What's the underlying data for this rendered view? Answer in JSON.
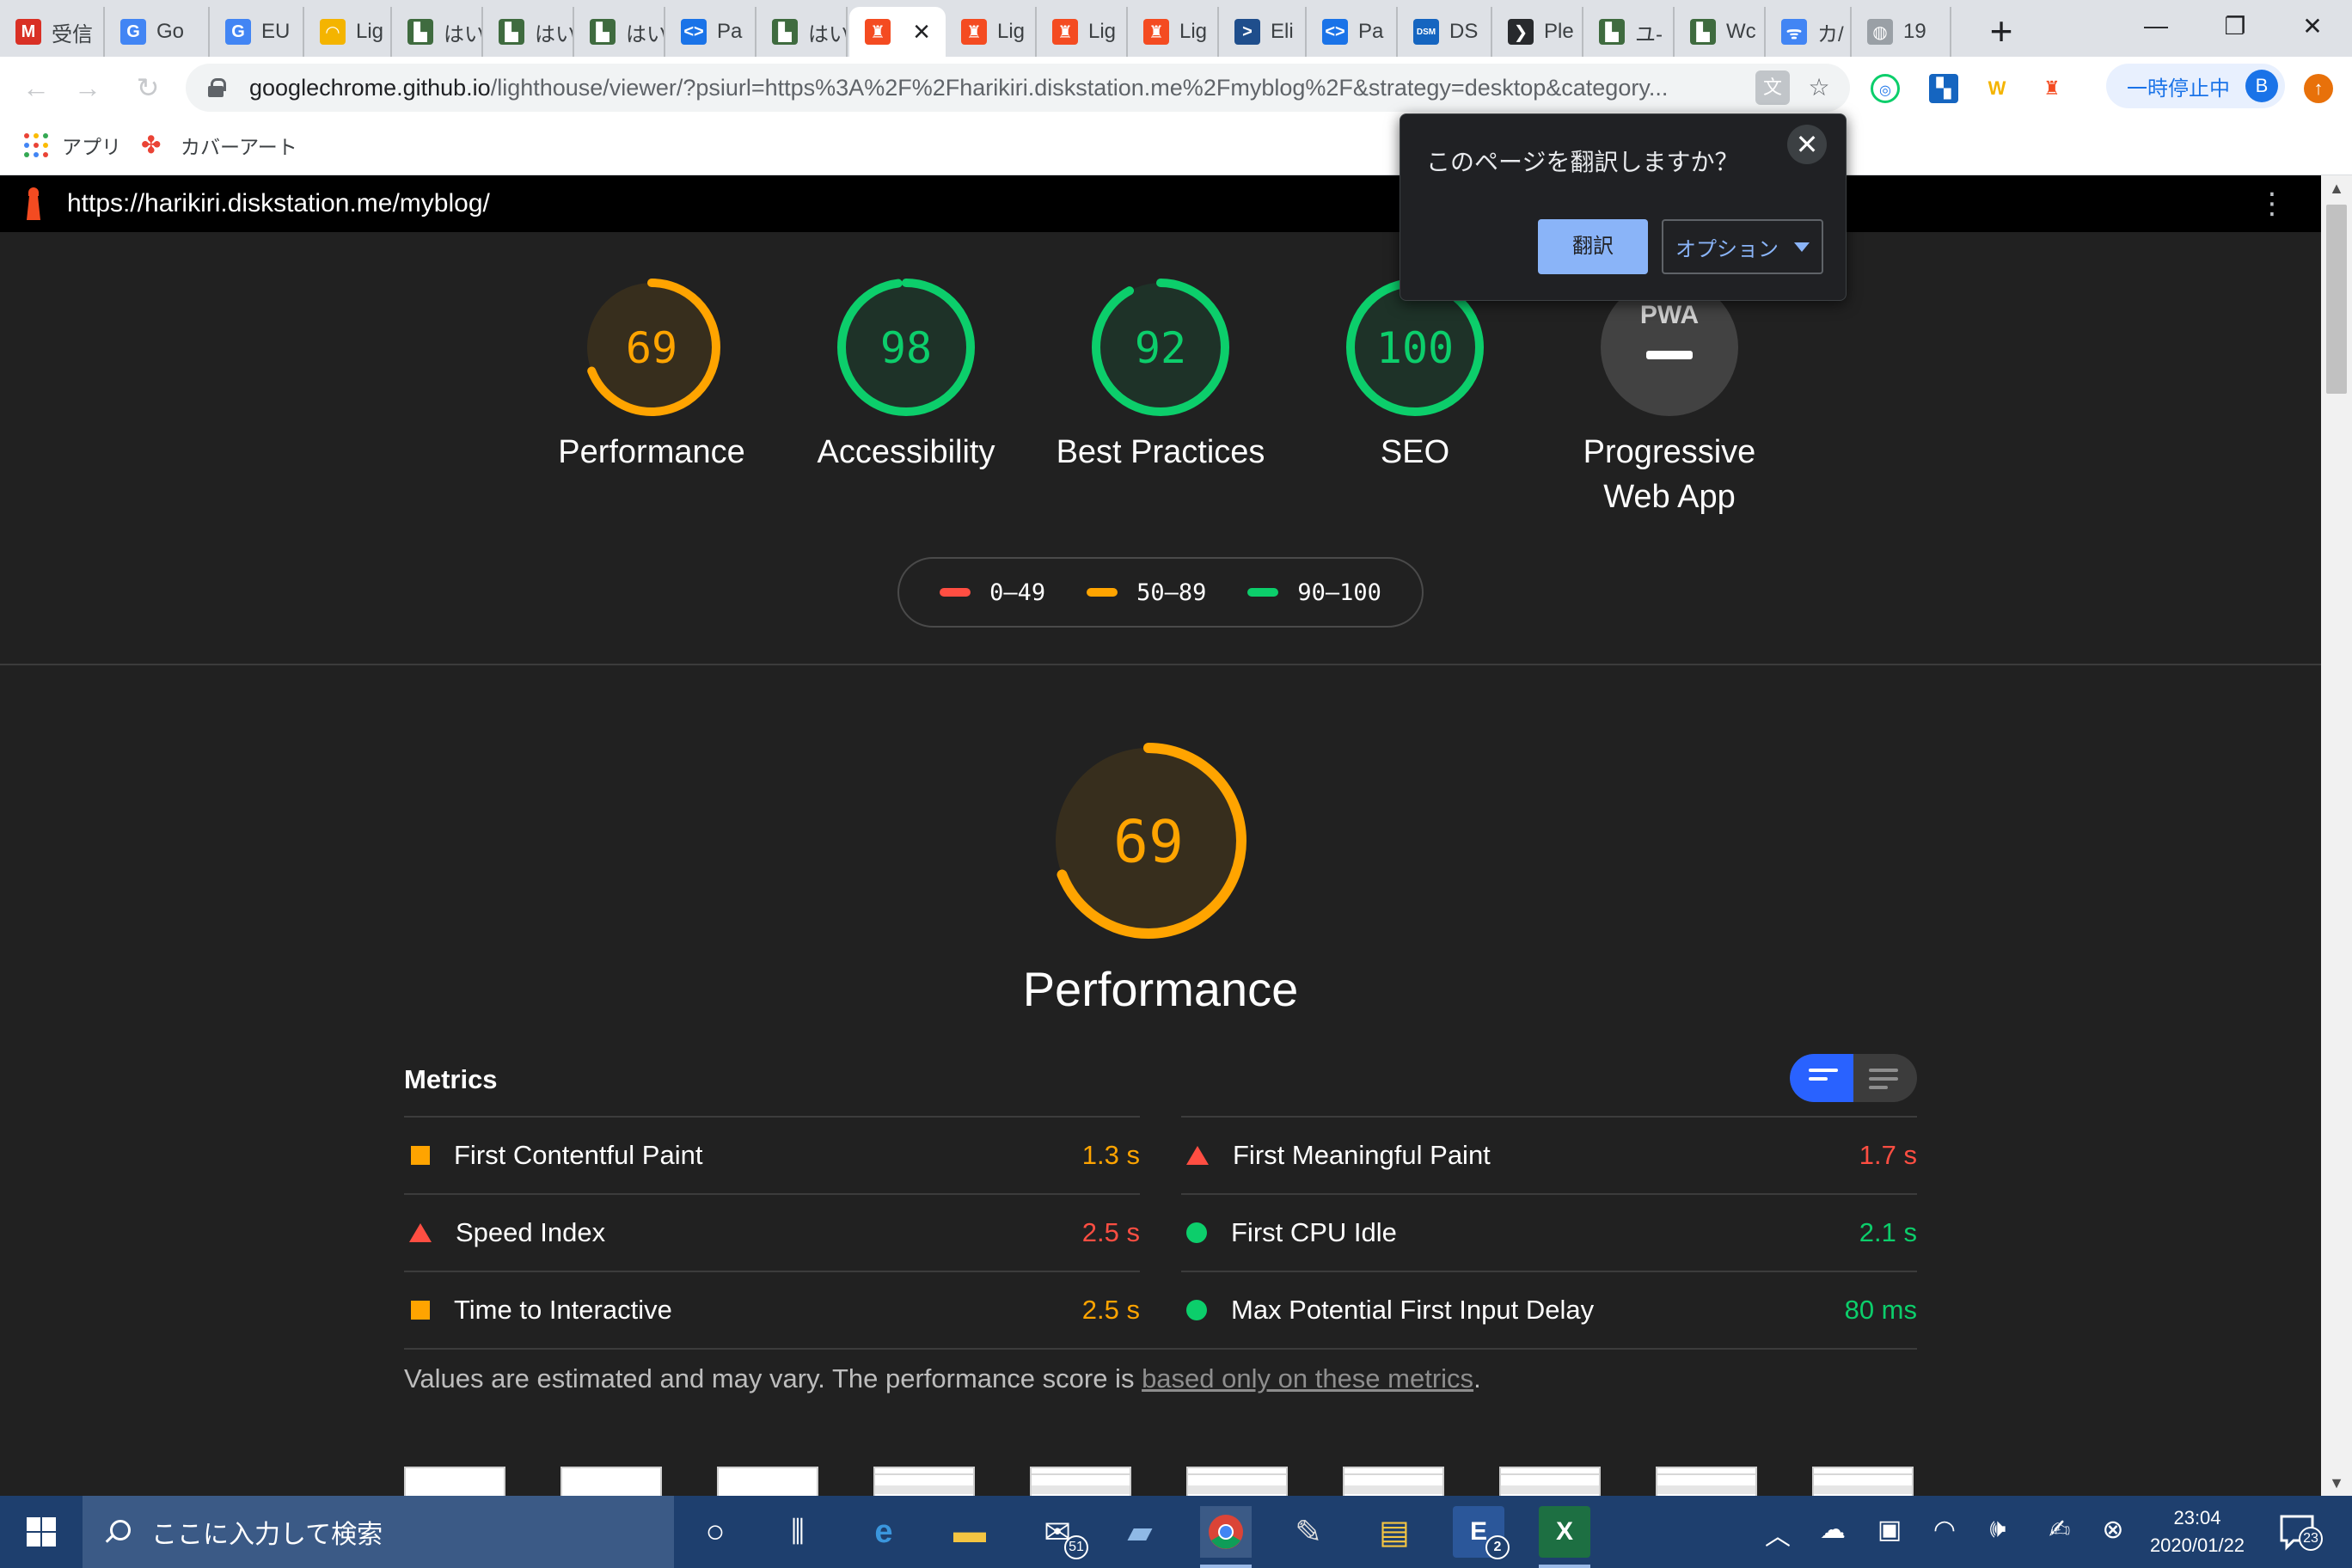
{
  "browser": {
    "tabs": [
      {
        "title": "受信",
        "icon": "gmail-icon",
        "color": "#d93025",
        "glyph": "M"
      },
      {
        "title": "Go",
        "icon": "google-icon",
        "color": "#4285f4",
        "glyph": "G"
      },
      {
        "title": "EU",
        "icon": "google-icon",
        "color": "#4285f4",
        "glyph": "G"
      },
      {
        "title": "Lig",
        "icon": "rainbow-icon",
        "color": "#f4b400",
        "glyph": "◠"
      },
      {
        "title": "はい",
        "icon": "photo-icon",
        "color": "#3f6b3f",
        "glyph": "▙"
      },
      {
        "title": "はい",
        "icon": "photo-icon",
        "color": "#3f6b3f",
        "glyph": "▙"
      },
      {
        "title": "はい",
        "icon": "photo-icon",
        "color": "#3f6b3f",
        "glyph": "▙"
      },
      {
        "title": "Pa",
        "icon": "pagespeed-icon",
        "color": "#1a73e8",
        "glyph": "<>"
      },
      {
        "title": "はい",
        "icon": "photo-icon",
        "color": "#3f6b3f",
        "glyph": "▙"
      },
      {
        "title": "",
        "icon": "lighthouse-icon",
        "color": "#f44b21",
        "glyph": "♜",
        "active": true
      },
      {
        "title": "Lig",
        "icon": "lighthouse-icon",
        "color": "#f44b21",
        "glyph": "♜"
      },
      {
        "title": "Lig",
        "icon": "lighthouse-icon",
        "color": "#f44b21",
        "glyph": "♜"
      },
      {
        "title": "Lig",
        "icon": "lighthouse-icon",
        "color": "#f44b21",
        "glyph": "♜"
      },
      {
        "title": "Eli",
        "icon": "powershell-icon",
        "color": "#1f4e8c",
        "glyph": ">"
      },
      {
        "title": "Pa",
        "icon": "pagespeed-icon",
        "color": "#1a73e8",
        "glyph": "<>"
      },
      {
        "title": "DS",
        "icon": "dsm-icon",
        "color": "#1565c0",
        "glyph": "DSM"
      },
      {
        "title": "Ple",
        "icon": "plex-icon",
        "color": "#282a2d",
        "glyph": "❯"
      },
      {
        "title": "ユ-",
        "icon": "photo-icon",
        "color": "#3f6b3f",
        "glyph": "▙"
      },
      {
        "title": "Wc",
        "icon": "photo-icon",
        "color": "#3f6b3f",
        "glyph": "▙"
      },
      {
        "title": "カ/",
        "icon": "translate-icon",
        "color": "#4285f4",
        "glyph": "ᯤ"
      },
      {
        "title": "19",
        "icon": "globe-icon",
        "color": "#9aa0a6",
        "glyph": "◍"
      }
    ],
    "new_tab": "+",
    "window": {
      "minimize": "—",
      "restore": "❐",
      "close": "✕"
    },
    "url_host": "googlechrome.github.io",
    "url_rest": "/lighthouse/viewer/?psiurl=https%3A%2F%2Fharikiri.diskstation.me%2Fmyblog%2F&strategy=desktop&category...",
    "paused_label": "一時停止中",
    "avatar_letter": "B",
    "bookmarks": [
      {
        "label": "アプリ",
        "icon": "apps-grid-icon"
      },
      {
        "label": "カバーアート",
        "icon": "pinwheel-icon"
      }
    ]
  },
  "translate_popup": {
    "question": "このページを翻訳しますか？",
    "translate_label": "翻訳",
    "options_label": "オプション",
    "close": "✕"
  },
  "report": {
    "url": "https://harikiri.diskstation.me/myblog/",
    "colors": {
      "fail": "#ff4e42",
      "average": "#ffa400",
      "pass": "#0cce6b",
      "pwa": "#424242"
    },
    "categories": [
      {
        "label": "Performance",
        "score": 69,
        "rating": "average"
      },
      {
        "label": "Accessibility",
        "score": 98,
        "rating": "pass"
      },
      {
        "label": "Best Practices",
        "score": 92,
        "rating": "pass"
      },
      {
        "label": "SEO",
        "score": 100,
        "rating": "pass"
      },
      {
        "label": "Progressive\nWeb App",
        "score": null,
        "rating": "pwa",
        "badge": "PWA"
      }
    ],
    "legend": [
      {
        "range": "0–49",
        "rating": "fail"
      },
      {
        "range": "50–89",
        "rating": "average"
      },
      {
        "range": "90–100",
        "rating": "pass"
      }
    ],
    "performance": {
      "score": 69,
      "title": "Performance",
      "metrics_heading": "Metrics",
      "metrics": [
        {
          "label": "First Contentful Paint",
          "value": "1.3 s",
          "rating": "average",
          "shape": "square"
        },
        {
          "label": "First Meaningful Paint",
          "value": "1.7 s",
          "rating": "fail",
          "shape": "triangle"
        },
        {
          "label": "Speed Index",
          "value": "2.5 s",
          "rating": "fail",
          "shape": "triangle"
        },
        {
          "label": "First CPU Idle",
          "value": "2.1 s",
          "rating": "pass",
          "shape": "circle"
        },
        {
          "label": "Time to Interactive",
          "value": "2.5 s",
          "rating": "average",
          "shape": "square"
        },
        {
          "label": "Max Potential First Input Delay",
          "value": "80 ms",
          "rating": "pass",
          "shape": "circle"
        }
      ],
      "note_text": "Values are estimated and may vary. The performance score is ",
      "note_link": "based only on these metrics",
      "note_end": "."
    }
  },
  "taskbar": {
    "search_placeholder": "ここに入力して検索",
    "mail_badge": "51",
    "word_badge": "2",
    "time": "23:04",
    "date": "2020/01/22",
    "notif_count": "23"
  }
}
